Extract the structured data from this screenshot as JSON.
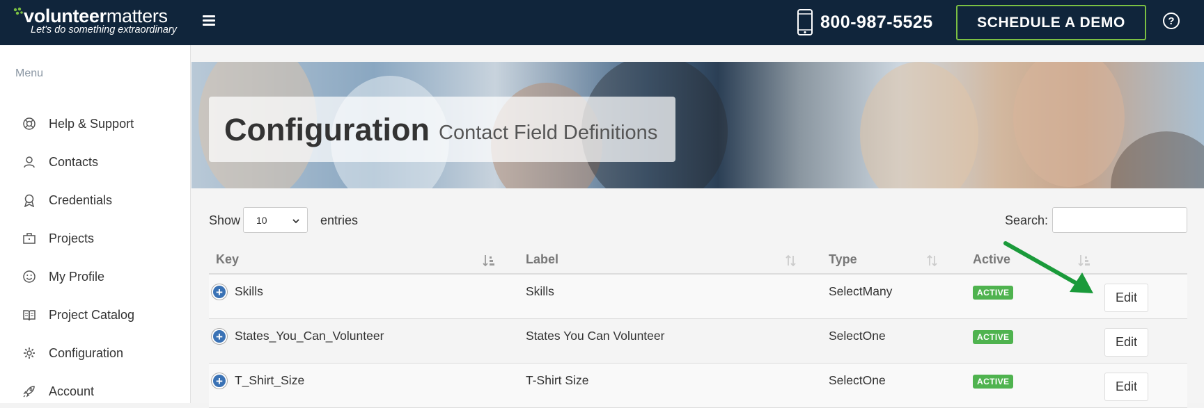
{
  "header": {
    "logo_word_bold": "volunteer",
    "logo_word_thin": "matters",
    "logo_tagline": "Let's do something extraordinary",
    "phone": "800-987-5525",
    "demo_button": "SCHEDULE A DEMO",
    "help_label": "?",
    "colors": {
      "bar": "#10253b",
      "accent": "#7bc043"
    }
  },
  "sidebar": {
    "title": "Menu",
    "items": [
      {
        "label": "Help & Support",
        "icon": "lifebuoy-icon"
      },
      {
        "label": "Contacts",
        "icon": "user-icon"
      },
      {
        "label": "Credentials",
        "icon": "award-icon"
      },
      {
        "label": "Projects",
        "icon": "briefcase-icon"
      },
      {
        "label": "My Profile",
        "icon": "smiley-icon"
      },
      {
        "label": "Project Catalog",
        "icon": "book-icon"
      },
      {
        "label": "Configuration",
        "icon": "gear-icon"
      },
      {
        "label": "Account",
        "icon": "rocket-icon"
      }
    ]
  },
  "page": {
    "title": "Configuration",
    "subtitle": "Contact Field Definitions"
  },
  "table_controls": {
    "show_label": "Show",
    "page_length": "10",
    "entries_label": "entries",
    "search_label": "Search:",
    "search_value": ""
  },
  "table": {
    "columns": [
      "Key",
      "Label",
      "Type",
      "Active"
    ],
    "rows": [
      {
        "key": "Skills",
        "label": "Skills",
        "type": "SelectMany",
        "active": "ACTIVE",
        "action": "Edit"
      },
      {
        "key": "States_You_Can_Volunteer",
        "label": "States You Can Volunteer",
        "type": "SelectOne",
        "active": "ACTIVE",
        "action": "Edit"
      },
      {
        "key": "T_Shirt_Size",
        "label": "T-Shirt Size",
        "type": "SelectOne",
        "active": "ACTIVE",
        "action": "Edit"
      }
    ],
    "expand_label": "+",
    "status_color": "#4fb34f"
  },
  "annotation": {
    "arrow_color": "#1a9a3a"
  }
}
